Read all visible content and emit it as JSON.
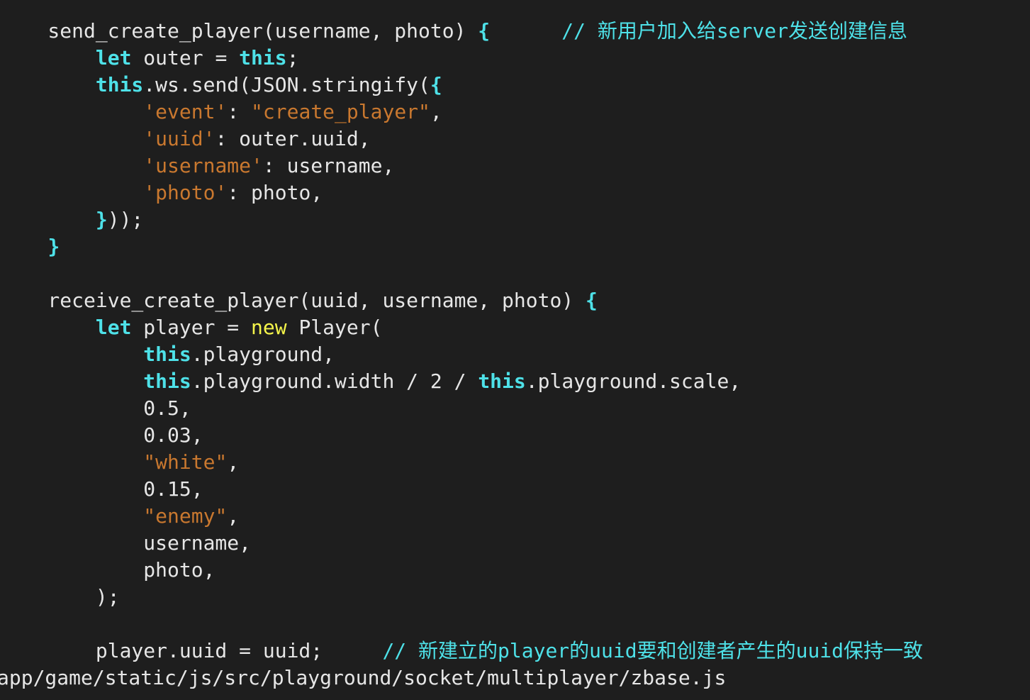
{
  "file_path": "app/game/static/js/src/playground/socket/multiplayer/zbase.js",
  "code_lines": [
    [
      {
        "t": "    send_create_player(username, photo) ",
        "c": "plain"
      },
      {
        "t": "{",
        "c": "kw"
      },
      {
        "t": "      // 新用户加入给server发送创建信息",
        "c": "cm"
      }
    ],
    [
      {
        "t": "        ",
        "c": "plain"
      },
      {
        "t": "let",
        "c": "kw"
      },
      {
        "t": " outer = ",
        "c": "plain"
      },
      {
        "t": "this",
        "c": "kw"
      },
      {
        "t": ";",
        "c": "plain"
      }
    ],
    [
      {
        "t": "        ",
        "c": "plain"
      },
      {
        "t": "this",
        "c": "kw"
      },
      {
        "t": ".ws.send(JSON.stringify(",
        "c": "plain"
      },
      {
        "t": "{",
        "c": "kw"
      }
    ],
    [
      {
        "t": "            ",
        "c": "plain"
      },
      {
        "t": "'event'",
        "c": "str"
      },
      {
        "t": ": ",
        "c": "plain"
      },
      {
        "t": "\"create_player\"",
        "c": "str"
      },
      {
        "t": ",",
        "c": "plain"
      }
    ],
    [
      {
        "t": "            ",
        "c": "plain"
      },
      {
        "t": "'uuid'",
        "c": "str"
      },
      {
        "t": ": outer.uuid,",
        "c": "plain"
      }
    ],
    [
      {
        "t": "            ",
        "c": "plain"
      },
      {
        "t": "'username'",
        "c": "str"
      },
      {
        "t": ": username,",
        "c": "plain"
      }
    ],
    [
      {
        "t": "            ",
        "c": "plain"
      },
      {
        "t": "'photo'",
        "c": "str"
      },
      {
        "t": ": photo,",
        "c": "plain"
      }
    ],
    [
      {
        "t": "        ",
        "c": "plain"
      },
      {
        "t": "}",
        "c": "kw"
      },
      {
        "t": "));",
        "c": "plain"
      }
    ],
    [
      {
        "t": "    ",
        "c": "plain"
      },
      {
        "t": "}",
        "c": "kw"
      }
    ],
    [
      {
        "t": "",
        "c": "plain"
      }
    ],
    [
      {
        "t": "    receive_create_player(uuid, username, photo) ",
        "c": "plain"
      },
      {
        "t": "{",
        "c": "kw"
      }
    ],
    [
      {
        "t": "        ",
        "c": "plain"
      },
      {
        "t": "let",
        "c": "kw"
      },
      {
        "t": " player = ",
        "c": "plain"
      },
      {
        "t": "new",
        "c": "kw-new"
      },
      {
        "t": " Player(",
        "c": "plain"
      }
    ],
    [
      {
        "t": "            ",
        "c": "plain"
      },
      {
        "t": "this",
        "c": "kw"
      },
      {
        "t": ".playground,",
        "c": "plain"
      }
    ],
    [
      {
        "t": "            ",
        "c": "plain"
      },
      {
        "t": "this",
        "c": "kw"
      },
      {
        "t": ".playground.width / 2 / ",
        "c": "plain"
      },
      {
        "t": "this",
        "c": "kw"
      },
      {
        "t": ".playground.scale,",
        "c": "plain"
      }
    ],
    [
      {
        "t": "            0.5,",
        "c": "plain"
      }
    ],
    [
      {
        "t": "            0.03,",
        "c": "plain"
      }
    ],
    [
      {
        "t": "            ",
        "c": "plain"
      },
      {
        "t": "\"white\"",
        "c": "str"
      },
      {
        "t": ",",
        "c": "plain"
      }
    ],
    [
      {
        "t": "            0.15,",
        "c": "plain"
      }
    ],
    [
      {
        "t": "            ",
        "c": "plain"
      },
      {
        "t": "\"enemy\"",
        "c": "str"
      },
      {
        "t": ",",
        "c": "plain"
      }
    ],
    [
      {
        "t": "            username,",
        "c": "plain"
      }
    ],
    [
      {
        "t": "            photo,",
        "c": "plain"
      }
    ],
    [
      {
        "t": "        );",
        "c": "plain"
      }
    ],
    [
      {
        "t": "",
        "c": "plain"
      }
    ],
    [
      {
        "t": "        player.uuid = uuid;     ",
        "c": "plain"
      },
      {
        "t": "// 新建立的player的uuid要和创建者产生的uuid保持一致",
        "c": "cm"
      }
    ]
  ],
  "colors": {
    "background": "#1e1e1e",
    "plain": "#e6e6e6",
    "keyword": "#4ee1e8",
    "new_keyword": "#f5f54a",
    "string": "#c9782f",
    "comment": "#4ee1e8"
  }
}
